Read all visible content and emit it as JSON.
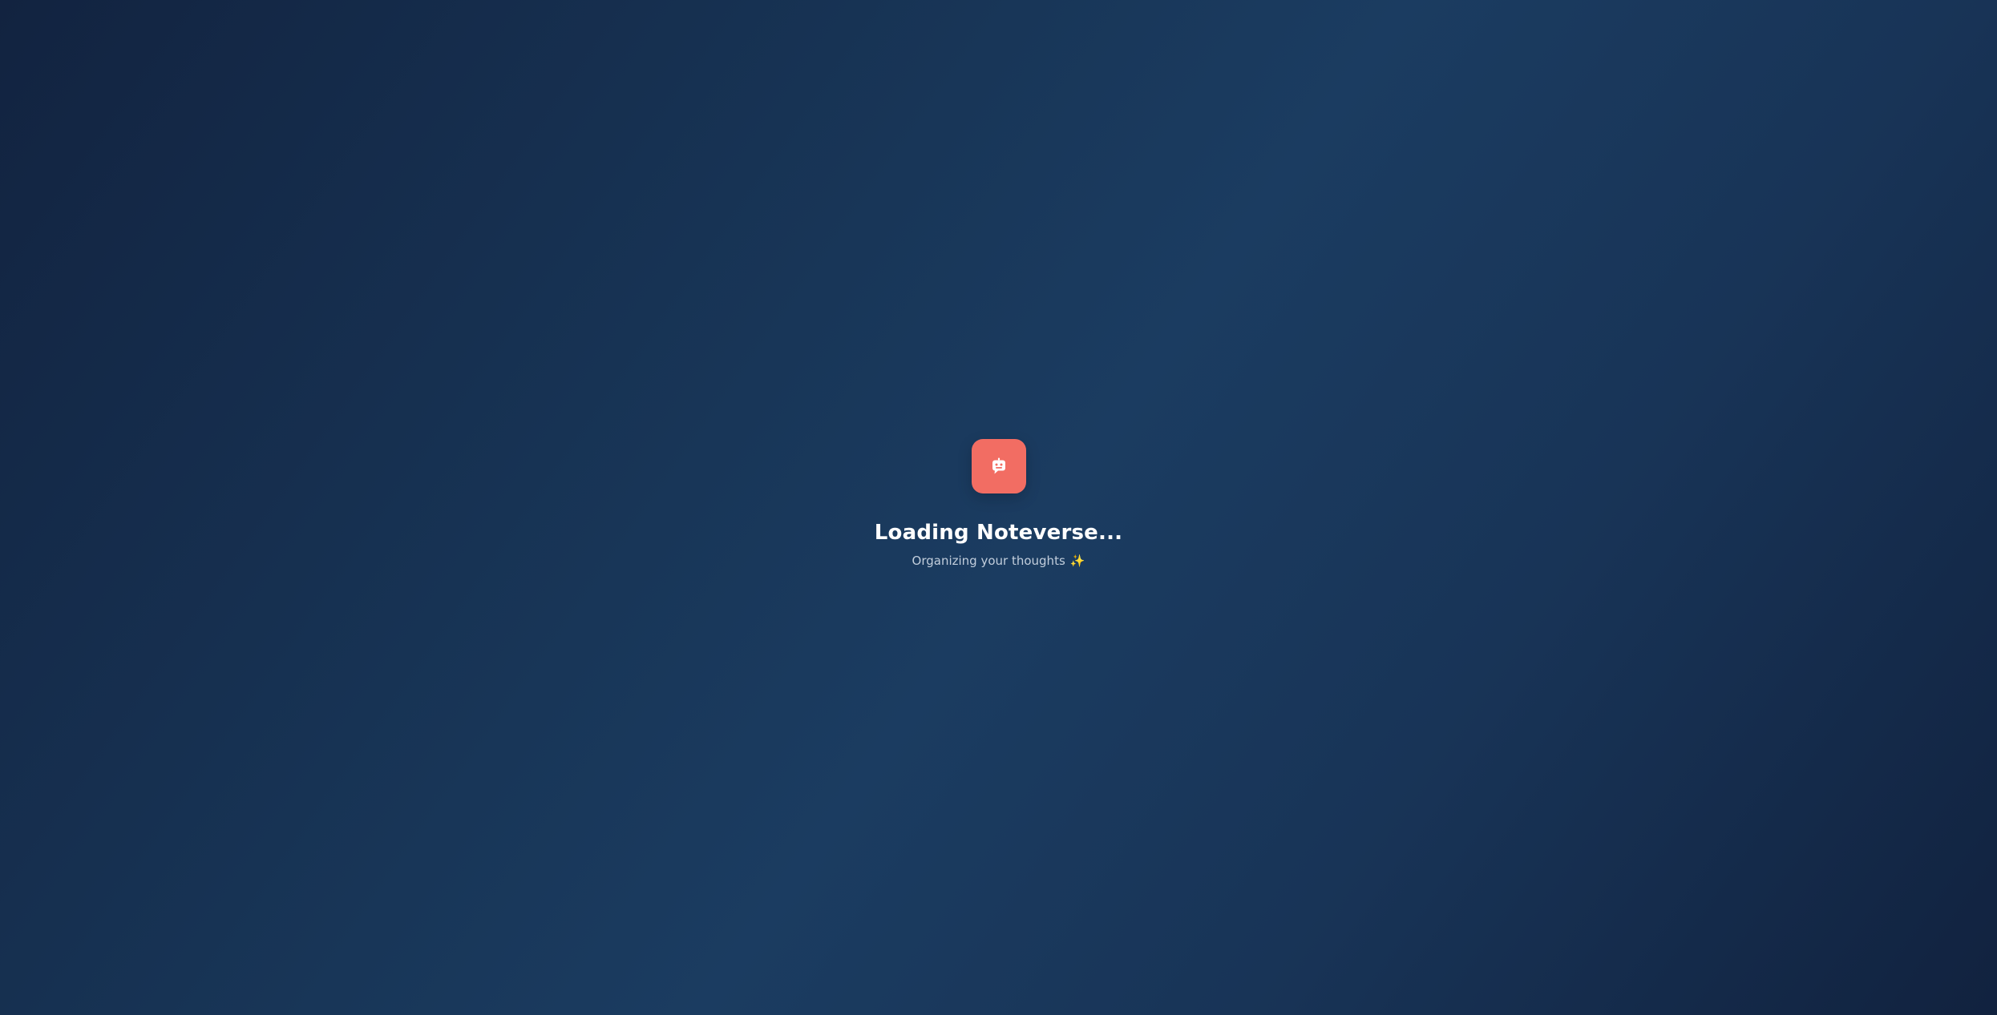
{
  "loader": {
    "title": "Loading Noteverse...",
    "subtitle": "Organizing your thoughts",
    "subtitle_emoji": "✨",
    "logo_icon": "robot-chat-icon",
    "accent_color": "#f26d63"
  }
}
